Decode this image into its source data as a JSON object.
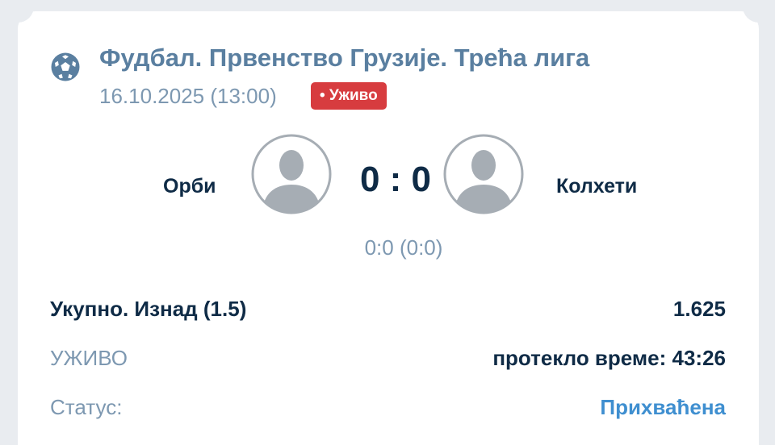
{
  "event": {
    "sport_icon": "football-icon",
    "title": "Фудбал. Првенство Грузије. Трећа лига",
    "datetime": "16.10.2025 (13:00)",
    "live_badge": "• Уживо"
  },
  "match": {
    "home_team": "Орби",
    "away_team": "Колхети",
    "home_avatar_icon": "team-avatar-placeholder-icon",
    "away_avatar_icon": "team-avatar-placeholder-icon",
    "score": "0 : 0",
    "score_detail": "0:0 (0:0)"
  },
  "bet": {
    "market": "Укупно. Изнад (1.5)",
    "odds": "1.625",
    "live_label": "УЖИВО",
    "elapsed": "протекло време: 43:26",
    "status_label": "Статус:",
    "status_value": "Прихваћена"
  },
  "colors": {
    "title": "#5a7fa0",
    "muted": "#7d98b1",
    "dark": "#0f2b46",
    "live_badge": "#d73c3f",
    "status_accepted": "#3f8fd0",
    "avatar": "#a6adb4"
  }
}
